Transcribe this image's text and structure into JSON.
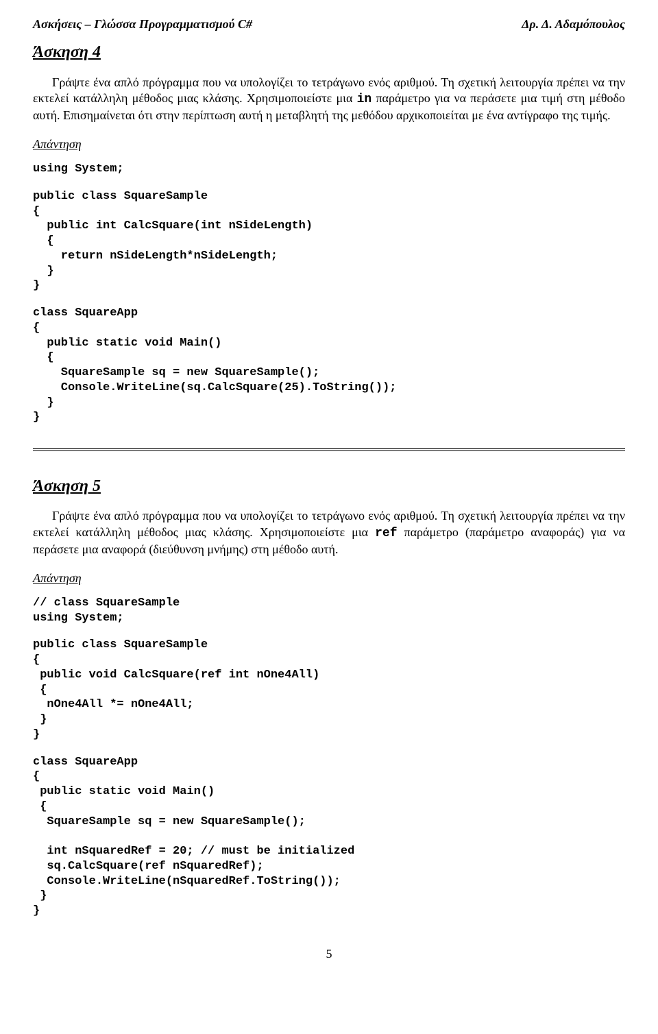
{
  "header": {
    "left": "Ασκήσεις – Γλώσσα Προγραμματισμού C#",
    "right": "Δρ. Δ. Αδαμόπουλος"
  },
  "ex4": {
    "title": "Άσκηση 4",
    "para_a": "Γράψτε ένα απλό πρόγραμμα που να υπολογίζει το τετράγωνο ενός αριθμού. Τη σχετική λειτουργία πρέπει να την εκτελεί κατάλληλη μέθοδος μιας κλάσης. Χρησιμοποιείστε μια ",
    "code_inline": "in",
    "para_b": " παράμετρο για να περάσετε μια τιμή στη μέθοδο αυτή. Επισημαίνεται ότι στην περίπτωση αυτή η μεταβλητή της μεθόδου αρχικοποιείται με ένα αντίγραφο της τιμής.",
    "answer_label": "Απάντηση",
    "code1": "using System;",
    "code2": "public class SquareSample\n{\n  public int CalcSquare(int nSideLength)\n  {\n    return nSideLength*nSideLength;\n  }\n}",
    "code3": "class SquareApp\n{\n  public static void Main()\n  {\n    SquareSample sq = new SquareSample();\n    Console.WriteLine(sq.CalcSquare(25).ToString());\n  }\n}"
  },
  "ex5": {
    "title": "Άσκηση 5",
    "para_a": "Γράψτε ένα απλό πρόγραμμα που να υπολογίζει το τετράγωνο ενός αριθμού. Τη σχετική λειτουργία πρέπει να την εκτελεί κατάλληλη μέθοδος μιας κλάσης. Χρησιμοποιείστε μια ",
    "code_inline": "ref",
    "para_b": " παράμετρο (παράμετρο αναφοράς) για να περάσετε μια αναφορά (διεύθυνση μνήμης) στη μέθοδο αυτή.",
    "answer_label": "Απάντηση",
    "code1": "// class SquareSample\nusing System;",
    "code2": "public class SquareSample\n{\n public void CalcSquare(ref int nOne4All)\n {\n  nOne4All *= nOne4All;\n }\n}",
    "code3": "class SquareApp\n{\n public static void Main()\n {\n  SquareSample sq = new SquareSample();\n\n  int nSquaredRef = 20; // must be initialized\n  sq.CalcSquare(ref nSquaredRef);\n  Console.WriteLine(nSquaredRef.ToString());\n }\n}"
  },
  "pagenum": "5"
}
